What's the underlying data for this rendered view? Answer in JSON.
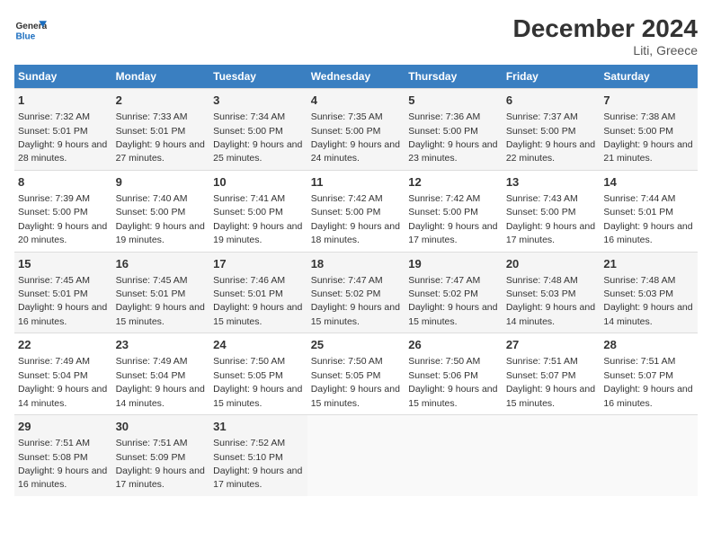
{
  "header": {
    "logo_general": "General",
    "logo_blue": "Blue",
    "month_title": "December 2024",
    "location": "Liti, Greece"
  },
  "weekdays": [
    "Sunday",
    "Monday",
    "Tuesday",
    "Wednesday",
    "Thursday",
    "Friday",
    "Saturday"
  ],
  "weeks": [
    [
      {
        "day": "1",
        "sunrise": "7:32 AM",
        "sunset": "5:01 PM",
        "daylight_hours": "9",
        "daylight_minutes": "28"
      },
      {
        "day": "2",
        "sunrise": "7:33 AM",
        "sunset": "5:01 PM",
        "daylight_hours": "9",
        "daylight_minutes": "27"
      },
      {
        "day": "3",
        "sunrise": "7:34 AM",
        "sunset": "5:00 PM",
        "daylight_hours": "9",
        "daylight_minutes": "25"
      },
      {
        "day": "4",
        "sunrise": "7:35 AM",
        "sunset": "5:00 PM",
        "daylight_hours": "9",
        "daylight_minutes": "24"
      },
      {
        "day": "5",
        "sunrise": "7:36 AM",
        "sunset": "5:00 PM",
        "daylight_hours": "9",
        "daylight_minutes": "23"
      },
      {
        "day": "6",
        "sunrise": "7:37 AM",
        "sunset": "5:00 PM",
        "daylight_hours": "9",
        "daylight_minutes": "22"
      },
      {
        "day": "7",
        "sunrise": "7:38 AM",
        "sunset": "5:00 PM",
        "daylight_hours": "9",
        "daylight_minutes": "21"
      }
    ],
    [
      {
        "day": "8",
        "sunrise": "7:39 AM",
        "sunset": "5:00 PM",
        "daylight_hours": "9",
        "daylight_minutes": "20"
      },
      {
        "day": "9",
        "sunrise": "7:40 AM",
        "sunset": "5:00 PM",
        "daylight_hours": "9",
        "daylight_minutes": "19"
      },
      {
        "day": "10",
        "sunrise": "7:41 AM",
        "sunset": "5:00 PM",
        "daylight_hours": "9",
        "daylight_minutes": "19"
      },
      {
        "day": "11",
        "sunrise": "7:42 AM",
        "sunset": "5:00 PM",
        "daylight_hours": "9",
        "daylight_minutes": "18"
      },
      {
        "day": "12",
        "sunrise": "7:42 AM",
        "sunset": "5:00 PM",
        "daylight_hours": "9",
        "daylight_minutes": "17"
      },
      {
        "day": "13",
        "sunrise": "7:43 AM",
        "sunset": "5:00 PM",
        "daylight_hours": "9",
        "daylight_minutes": "17"
      },
      {
        "day": "14",
        "sunrise": "7:44 AM",
        "sunset": "5:01 PM",
        "daylight_hours": "9",
        "daylight_minutes": "16"
      }
    ],
    [
      {
        "day": "15",
        "sunrise": "7:45 AM",
        "sunset": "5:01 PM",
        "daylight_hours": "9",
        "daylight_minutes": "16"
      },
      {
        "day": "16",
        "sunrise": "7:45 AM",
        "sunset": "5:01 PM",
        "daylight_hours": "9",
        "daylight_minutes": "15"
      },
      {
        "day": "17",
        "sunrise": "7:46 AM",
        "sunset": "5:01 PM",
        "daylight_hours": "9",
        "daylight_minutes": "15"
      },
      {
        "day": "18",
        "sunrise": "7:47 AM",
        "sunset": "5:02 PM",
        "daylight_hours": "9",
        "daylight_minutes": "15"
      },
      {
        "day": "19",
        "sunrise": "7:47 AM",
        "sunset": "5:02 PM",
        "daylight_hours": "9",
        "daylight_minutes": "15"
      },
      {
        "day": "20",
        "sunrise": "7:48 AM",
        "sunset": "5:03 PM",
        "daylight_hours": "9",
        "daylight_minutes": "14"
      },
      {
        "day": "21",
        "sunrise": "7:48 AM",
        "sunset": "5:03 PM",
        "daylight_hours": "9",
        "daylight_minutes": "14"
      }
    ],
    [
      {
        "day": "22",
        "sunrise": "7:49 AM",
        "sunset": "5:04 PM",
        "daylight_hours": "9",
        "daylight_minutes": "14"
      },
      {
        "day": "23",
        "sunrise": "7:49 AM",
        "sunset": "5:04 PM",
        "daylight_hours": "9",
        "daylight_minutes": "14"
      },
      {
        "day": "24",
        "sunrise": "7:50 AM",
        "sunset": "5:05 PM",
        "daylight_hours": "9",
        "daylight_minutes": "15"
      },
      {
        "day": "25",
        "sunrise": "7:50 AM",
        "sunset": "5:05 PM",
        "daylight_hours": "9",
        "daylight_minutes": "15"
      },
      {
        "day": "26",
        "sunrise": "7:50 AM",
        "sunset": "5:06 PM",
        "daylight_hours": "9",
        "daylight_minutes": "15"
      },
      {
        "day": "27",
        "sunrise": "7:51 AM",
        "sunset": "5:07 PM",
        "daylight_hours": "9",
        "daylight_minutes": "15"
      },
      {
        "day": "28",
        "sunrise": "7:51 AM",
        "sunset": "5:07 PM",
        "daylight_hours": "9",
        "daylight_minutes": "16"
      }
    ],
    [
      {
        "day": "29",
        "sunrise": "7:51 AM",
        "sunset": "5:08 PM",
        "daylight_hours": "9",
        "daylight_minutes": "16"
      },
      {
        "day": "30",
        "sunrise": "7:51 AM",
        "sunset": "5:09 PM",
        "daylight_hours": "9",
        "daylight_minutes": "17"
      },
      {
        "day": "31",
        "sunrise": "7:52 AM",
        "sunset": "5:10 PM",
        "daylight_hours": "9",
        "daylight_minutes": "17"
      },
      null,
      null,
      null,
      null
    ]
  ],
  "labels": {
    "sunrise": "Sunrise:",
    "sunset": "Sunset:",
    "daylight": "Daylight:",
    "hours_suffix": "hours",
    "and": "and",
    "minutes_suffix": "minutes."
  }
}
